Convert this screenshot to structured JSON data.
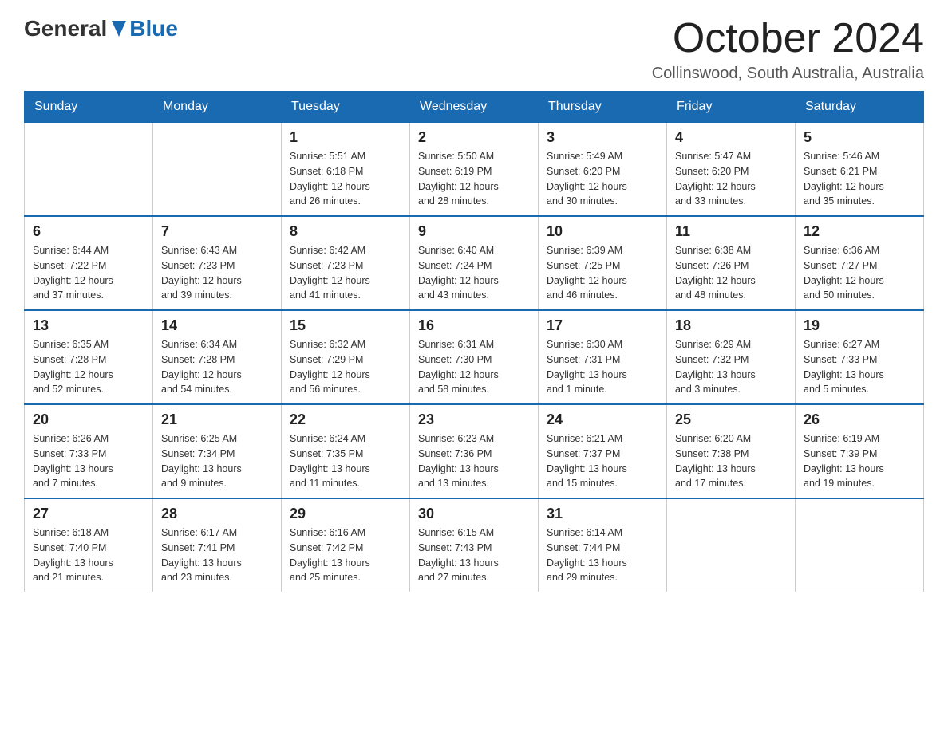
{
  "header": {
    "logo": {
      "general": "General",
      "blue": "Blue"
    },
    "title": "October 2024",
    "location": "Collinswood, South Australia, Australia"
  },
  "weekdays": [
    "Sunday",
    "Monday",
    "Tuesday",
    "Wednesday",
    "Thursday",
    "Friday",
    "Saturday"
  ],
  "weeks": [
    [
      {
        "day": "",
        "info": ""
      },
      {
        "day": "",
        "info": ""
      },
      {
        "day": "1",
        "info": "Sunrise: 5:51 AM\nSunset: 6:18 PM\nDaylight: 12 hours\nand 26 minutes."
      },
      {
        "day": "2",
        "info": "Sunrise: 5:50 AM\nSunset: 6:19 PM\nDaylight: 12 hours\nand 28 minutes."
      },
      {
        "day": "3",
        "info": "Sunrise: 5:49 AM\nSunset: 6:20 PM\nDaylight: 12 hours\nand 30 minutes."
      },
      {
        "day": "4",
        "info": "Sunrise: 5:47 AM\nSunset: 6:20 PM\nDaylight: 12 hours\nand 33 minutes."
      },
      {
        "day": "5",
        "info": "Sunrise: 5:46 AM\nSunset: 6:21 PM\nDaylight: 12 hours\nand 35 minutes."
      }
    ],
    [
      {
        "day": "6",
        "info": "Sunrise: 6:44 AM\nSunset: 7:22 PM\nDaylight: 12 hours\nand 37 minutes."
      },
      {
        "day": "7",
        "info": "Sunrise: 6:43 AM\nSunset: 7:23 PM\nDaylight: 12 hours\nand 39 minutes."
      },
      {
        "day": "8",
        "info": "Sunrise: 6:42 AM\nSunset: 7:23 PM\nDaylight: 12 hours\nand 41 minutes."
      },
      {
        "day": "9",
        "info": "Sunrise: 6:40 AM\nSunset: 7:24 PM\nDaylight: 12 hours\nand 43 minutes."
      },
      {
        "day": "10",
        "info": "Sunrise: 6:39 AM\nSunset: 7:25 PM\nDaylight: 12 hours\nand 46 minutes."
      },
      {
        "day": "11",
        "info": "Sunrise: 6:38 AM\nSunset: 7:26 PM\nDaylight: 12 hours\nand 48 minutes."
      },
      {
        "day": "12",
        "info": "Sunrise: 6:36 AM\nSunset: 7:27 PM\nDaylight: 12 hours\nand 50 minutes."
      }
    ],
    [
      {
        "day": "13",
        "info": "Sunrise: 6:35 AM\nSunset: 7:28 PM\nDaylight: 12 hours\nand 52 minutes."
      },
      {
        "day": "14",
        "info": "Sunrise: 6:34 AM\nSunset: 7:28 PM\nDaylight: 12 hours\nand 54 minutes."
      },
      {
        "day": "15",
        "info": "Sunrise: 6:32 AM\nSunset: 7:29 PM\nDaylight: 12 hours\nand 56 minutes."
      },
      {
        "day": "16",
        "info": "Sunrise: 6:31 AM\nSunset: 7:30 PM\nDaylight: 12 hours\nand 58 minutes."
      },
      {
        "day": "17",
        "info": "Sunrise: 6:30 AM\nSunset: 7:31 PM\nDaylight: 13 hours\nand 1 minute."
      },
      {
        "day": "18",
        "info": "Sunrise: 6:29 AM\nSunset: 7:32 PM\nDaylight: 13 hours\nand 3 minutes."
      },
      {
        "day": "19",
        "info": "Sunrise: 6:27 AM\nSunset: 7:33 PM\nDaylight: 13 hours\nand 5 minutes."
      }
    ],
    [
      {
        "day": "20",
        "info": "Sunrise: 6:26 AM\nSunset: 7:33 PM\nDaylight: 13 hours\nand 7 minutes."
      },
      {
        "day": "21",
        "info": "Sunrise: 6:25 AM\nSunset: 7:34 PM\nDaylight: 13 hours\nand 9 minutes."
      },
      {
        "day": "22",
        "info": "Sunrise: 6:24 AM\nSunset: 7:35 PM\nDaylight: 13 hours\nand 11 minutes."
      },
      {
        "day": "23",
        "info": "Sunrise: 6:23 AM\nSunset: 7:36 PM\nDaylight: 13 hours\nand 13 minutes."
      },
      {
        "day": "24",
        "info": "Sunrise: 6:21 AM\nSunset: 7:37 PM\nDaylight: 13 hours\nand 15 minutes."
      },
      {
        "day": "25",
        "info": "Sunrise: 6:20 AM\nSunset: 7:38 PM\nDaylight: 13 hours\nand 17 minutes."
      },
      {
        "day": "26",
        "info": "Sunrise: 6:19 AM\nSunset: 7:39 PM\nDaylight: 13 hours\nand 19 minutes."
      }
    ],
    [
      {
        "day": "27",
        "info": "Sunrise: 6:18 AM\nSunset: 7:40 PM\nDaylight: 13 hours\nand 21 minutes."
      },
      {
        "day": "28",
        "info": "Sunrise: 6:17 AM\nSunset: 7:41 PM\nDaylight: 13 hours\nand 23 minutes."
      },
      {
        "day": "29",
        "info": "Sunrise: 6:16 AM\nSunset: 7:42 PM\nDaylight: 13 hours\nand 25 minutes."
      },
      {
        "day": "30",
        "info": "Sunrise: 6:15 AM\nSunset: 7:43 PM\nDaylight: 13 hours\nand 27 minutes."
      },
      {
        "day": "31",
        "info": "Sunrise: 6:14 AM\nSunset: 7:44 PM\nDaylight: 13 hours\nand 29 minutes."
      },
      {
        "day": "",
        "info": ""
      },
      {
        "day": "",
        "info": ""
      }
    ]
  ]
}
